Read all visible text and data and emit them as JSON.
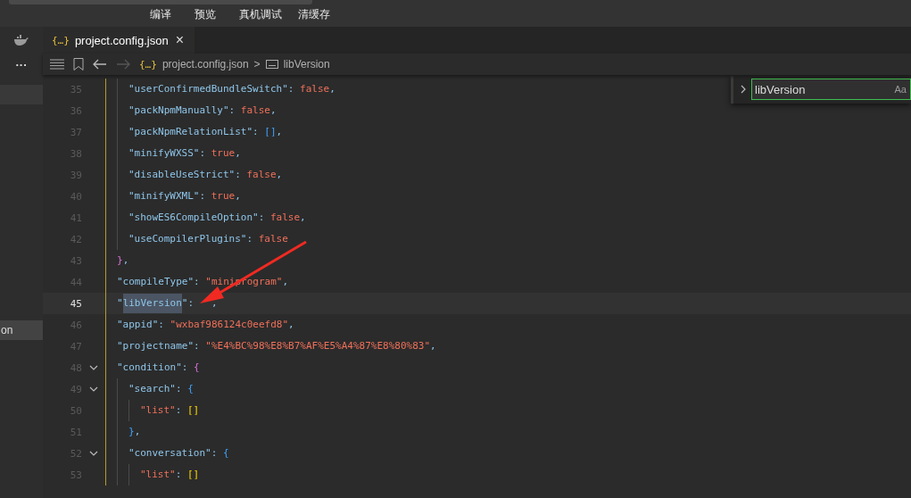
{
  "toolbar": {
    "buttons": [
      "编译",
      "预览",
      "真机调试",
      "清缓存"
    ]
  },
  "sidebar": {
    "more": "···",
    "items": [
      {
        "label": "on",
        "selected": true
      }
    ]
  },
  "tabs": [
    {
      "icon": "{…}",
      "label": "project.config.json",
      "selected": true,
      "close": "×"
    }
  ],
  "breadcrumb": {
    "file_icon": "{…}",
    "file": "project.config.json",
    "separator": ">",
    "symbol": "libVersion",
    "forward_disabled": true
  },
  "find": {
    "value": "libVersion",
    "match_case": "Aa"
  },
  "lines": [
    {
      "children": [
        {
          "children": [
            {
              "number": "35",
              "tokens": [
                {
                  "kind": "key",
                  "text": "\"userConfirmedBundleSwitch\""
                },
                {
                  "kind": "punct",
                  "text": ": "
                },
                {
                  "kind": "bool",
                  "text": "false"
                },
                {
                  "kind": "punct",
                  "text": ","
                }
              ]
            },
            {
              "number": "36",
              "tokens": [
                {
                  "kind": "key",
                  "text": "\"packNpmManually\""
                },
                {
                  "kind": "punct",
                  "text": ": "
                },
                {
                  "kind": "bool",
                  "text": "false"
                },
                {
                  "kind": "punct",
                  "text": ","
                }
              ]
            },
            {
              "number": "37",
              "tokens": [
                {
                  "kind": "key",
                  "text": "\"packNpmRelationList\""
                },
                {
                  "kind": "punct",
                  "text": ": "
                },
                {
                  "kind": "bracket2",
                  "text": "[]"
                },
                {
                  "kind": "punct",
                  "text": ","
                }
              ]
            },
            {
              "number": "38",
              "tokens": [
                {
                  "kind": "key",
                  "text": "\"minifyWXSS\""
                },
                {
                  "kind": "punct",
                  "text": ": "
                },
                {
                  "kind": "bool",
                  "text": "true"
                },
                {
                  "kind": "punct",
                  "text": ","
                }
              ]
            },
            {
              "number": "39",
              "tokens": [
                {
                  "kind": "key",
                  "text": "\"disableUseStrict\""
                },
                {
                  "kind": "punct",
                  "text": ": "
                },
                {
                  "kind": "bool",
                  "text": "false"
                },
                {
                  "kind": "punct",
                  "text": ","
                }
              ]
            },
            {
              "number": "40",
              "tokens": [
                {
                  "kind": "key",
                  "text": "\"minifyWXML\""
                },
                {
                  "kind": "punct",
                  "text": ": "
                },
                {
                  "kind": "bool",
                  "text": "true"
                },
                {
                  "kind": "punct",
                  "text": ","
                }
              ]
            },
            {
              "number": "41",
              "tokens": [
                {
                  "kind": "key",
                  "text": "\"showES6CompileOption\""
                },
                {
                  "kind": "punct",
                  "text": ": "
                },
                {
                  "kind": "bool",
                  "text": "false"
                },
                {
                  "kind": "punct",
                  "text": ","
                }
              ]
            },
            {
              "number": "42",
              "tokens": [
                {
                  "kind": "key",
                  "text": "\"useCompilerPlugins\""
                },
                {
                  "kind": "punct",
                  "text": ": "
                },
                {
                  "kind": "bool",
                  "text": "false"
                }
              ]
            }
          ]
        },
        {
          "number": "43",
          "tokens": [
            {
              "kind": "bracket1",
              "text": "}"
            },
            {
              "kind": "punct",
              "text": ","
            }
          ]
        },
        {
          "number": "44",
          "tokens": [
            {
              "kind": "key",
              "text": "\"compileType\""
            },
            {
              "kind": "punct",
              "text": ": "
            },
            {
              "kind": "string",
              "text": "\"miniprogram\""
            },
            {
              "kind": "punct",
              "text": ","
            }
          ]
        },
        {
          "number": "45",
          "current": true,
          "tokens": [
            {
              "kind": "punct",
              "text": "\""
            },
            {
              "kind": "key",
              "text": "libVersion",
              "match": true
            },
            {
              "kind": "punct",
              "text": "\":   ,"
            }
          ]
        },
        {
          "number": "46",
          "tokens": [
            {
              "kind": "key",
              "text": "\"appid\""
            },
            {
              "kind": "punct",
              "text": ": "
            },
            {
              "kind": "string",
              "text": "\"wxbaf986124c0eefd8\""
            },
            {
              "kind": "punct",
              "text": ","
            }
          ]
        },
        {
          "number": "47",
          "tokens": [
            {
              "kind": "key",
              "text": "\"projectname\""
            },
            {
              "kind": "punct",
              "text": ": "
            },
            {
              "kind": "string",
              "text": "\"%E4%BC%98%E8%B7%AF%E5%A4%87%E8%80%83\""
            },
            {
              "kind": "punct",
              "text": ","
            }
          ]
        },
        {
          "number": "48",
          "expanded": true,
          "tokens": [
            {
              "kind": "key",
              "text": "\"condition\""
            },
            {
              "kind": "punct",
              "text": ": "
            },
            {
              "kind": "bracket1",
              "text": "{"
            }
          ],
          "children": [
            {
              "number": "49",
              "expanded": true,
              "tokens": [
                {
                  "kind": "key",
                  "text": "\"search\""
                },
                {
                  "kind": "punct",
                  "text": ": "
                },
                {
                  "kind": "bracket2",
                  "text": "{"
                }
              ],
              "children": [
                {
                  "number": "50",
                  "tokens": [
                    {
                      "kind": "string",
                      "text": "\"list\""
                    },
                    {
                      "kind": "punct",
                      "text": ": "
                    },
                    {
                      "kind": "bracket3",
                      "text": "[]"
                    }
                  ]
                }
              ]
            },
            {
              "number": "51",
              "tokens": [
                {
                  "kind": "bracket2",
                  "text": "}"
                },
                {
                  "kind": "punct",
                  "text": ","
                }
              ]
            },
            {
              "number": "52",
              "expanded": true,
              "tokens": [
                {
                  "kind": "key",
                  "text": "\"conversation\""
                },
                {
                  "kind": "punct",
                  "text": ": "
                },
                {
                  "kind": "bracket2",
                  "text": "{"
                }
              ],
              "children": [
                {
                  "number": "53",
                  "tokens": [
                    {
                      "kind": "string",
                      "text": "\"list\""
                    },
                    {
                      "kind": "punct",
                      "text": ": "
                    },
                    {
                      "kind": "bracket3",
                      "text": "[]"
                    }
                  ]
                }
              ]
            }
          ]
        }
      ]
    }
  ]
}
